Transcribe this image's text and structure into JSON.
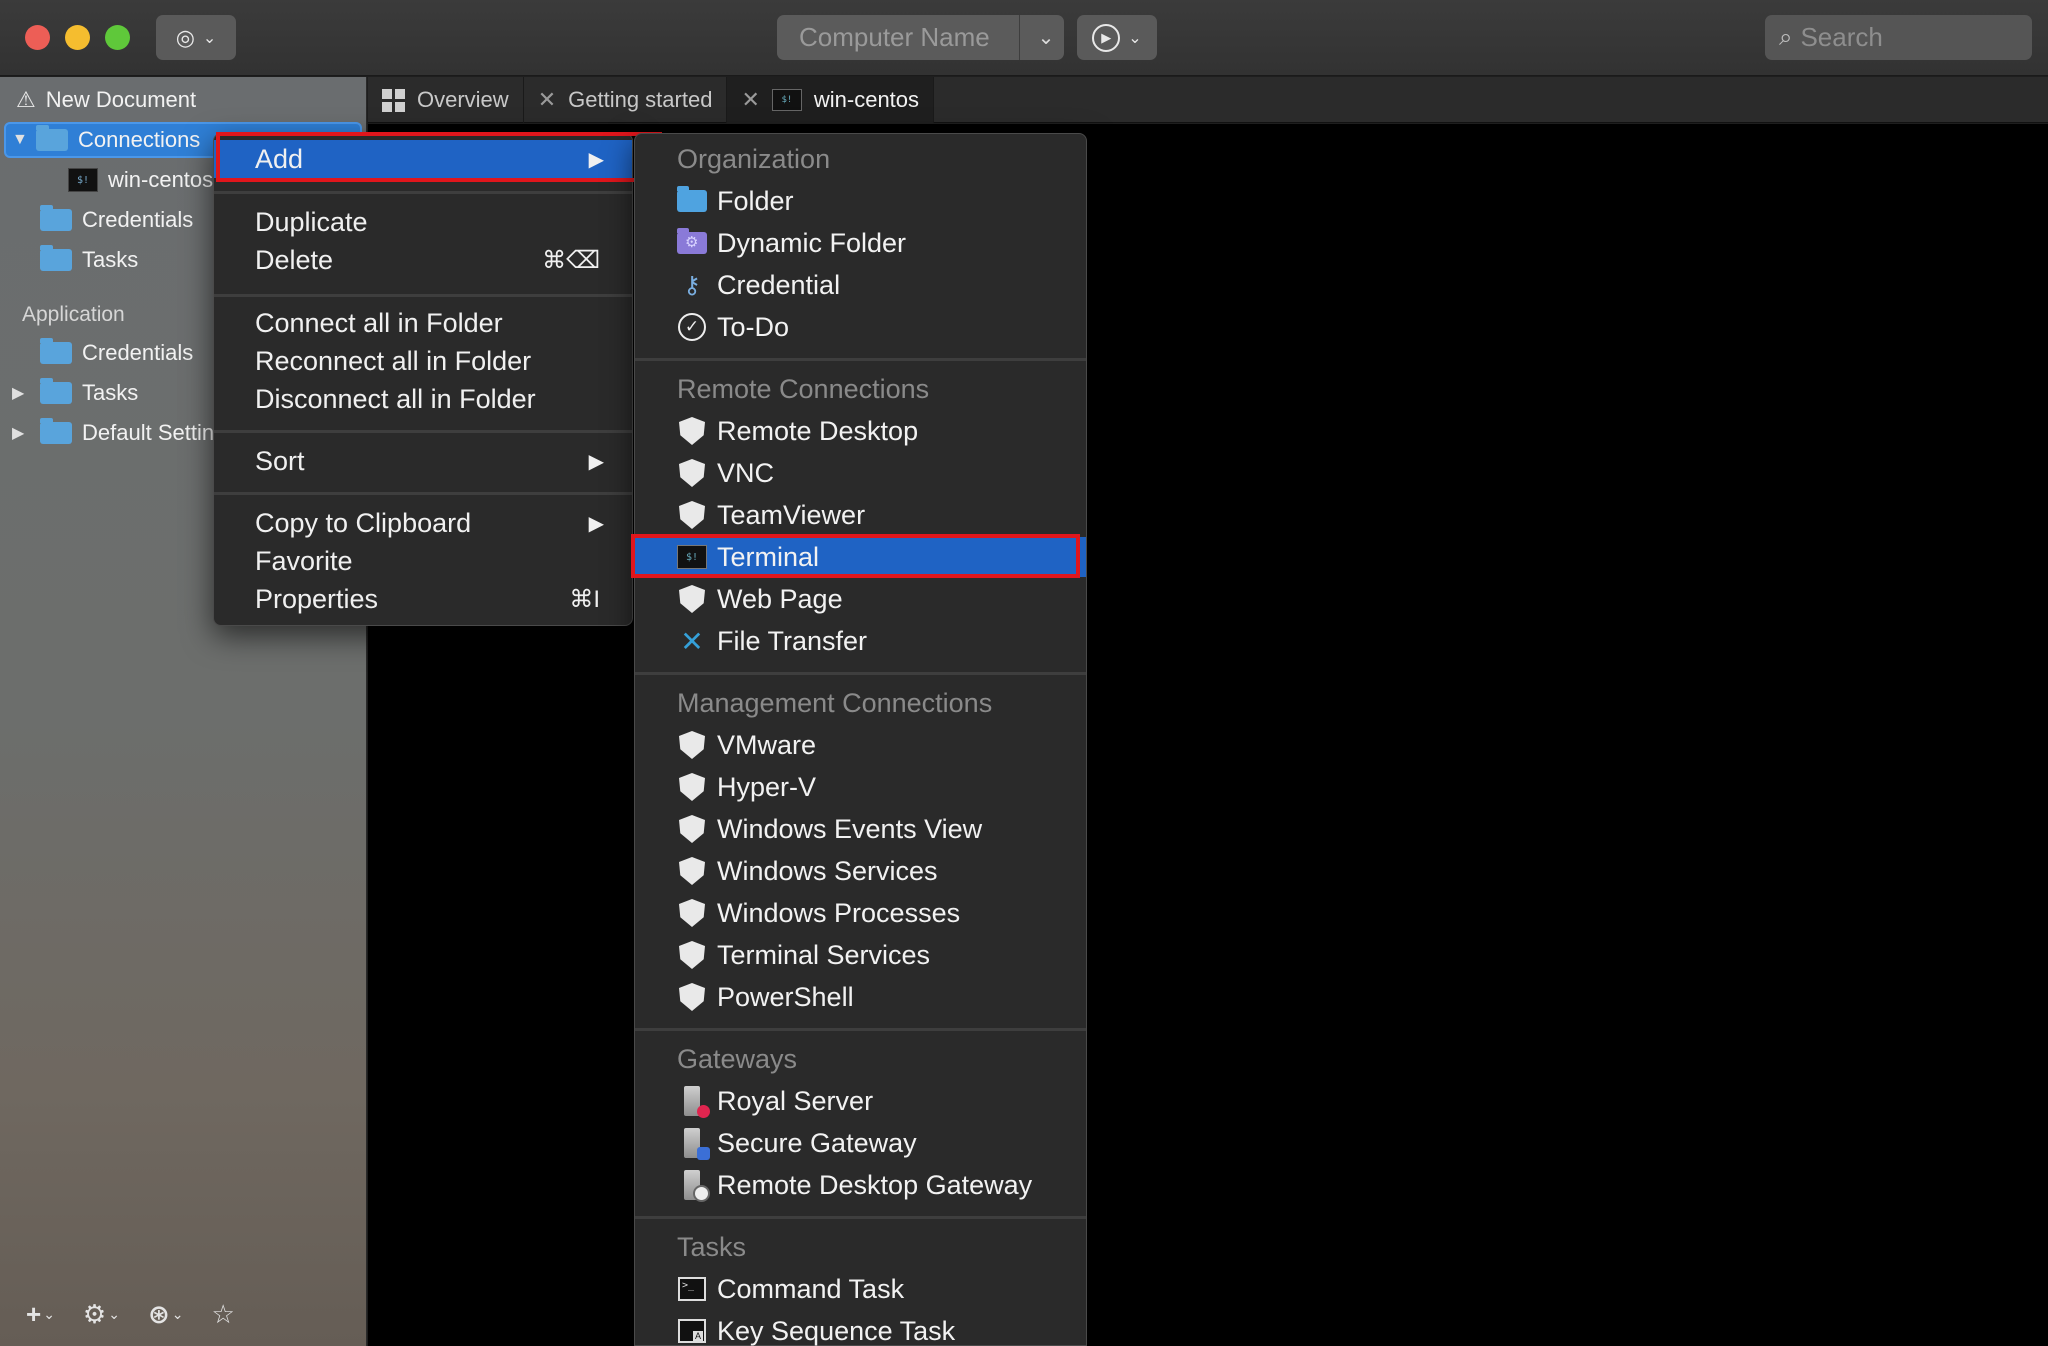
{
  "toolbar": {
    "computer_name_placeholder": "Computer Name",
    "search_placeholder": "Search"
  },
  "sidebar": {
    "document_title": "New Document",
    "document_items": [
      {
        "label": "Connections"
      },
      {
        "label": "win-centos"
      },
      {
        "label": "Credentials"
      },
      {
        "label": "Tasks"
      }
    ],
    "application_header": "Application",
    "application_items": [
      {
        "label": "Credentials"
      },
      {
        "label": "Tasks"
      },
      {
        "label": "Default Settings"
      }
    ]
  },
  "tabs": [
    {
      "label": "Overview"
    },
    {
      "label": "Getting started"
    },
    {
      "label": "win-centos"
    }
  ],
  "context_menu": {
    "add": "Add",
    "duplicate": "Duplicate",
    "delete": "Delete",
    "delete_shortcut": "⌘⌫",
    "connect_all": "Connect all in Folder",
    "reconnect_all": "Reconnect all in Folder",
    "disconnect_all": "Disconnect all in Folder",
    "sort": "Sort",
    "copy_clipboard": "Copy to Clipboard",
    "favorite": "Favorite",
    "properties": "Properties",
    "properties_shortcut": "⌘I"
  },
  "submenu": {
    "organization_header": "Organization",
    "organization": [
      "Folder",
      "Dynamic Folder",
      "Credential",
      "To-Do"
    ],
    "remote_header": "Remote Connections",
    "remote": [
      "Remote Desktop",
      "VNC",
      "TeamViewer",
      "Terminal",
      "Web Page",
      "File Transfer"
    ],
    "management_header": "Management Connections",
    "management": [
      "VMware",
      "Hyper-V",
      "Windows Events View",
      "Windows Services",
      "Windows Processes",
      "Terminal Services",
      "PowerShell"
    ],
    "gateways_header": "Gateways",
    "gateways": [
      "Royal Server",
      "Secure Gateway",
      "Remote Desktop Gateway"
    ],
    "tasks_header": "Tasks",
    "tasks": [
      "Command Task",
      "Key Sequence Task"
    ]
  },
  "colors": {
    "selection": "#1f63c4",
    "highlight_box": "#e0161c",
    "folder": "#59a4dc"
  }
}
